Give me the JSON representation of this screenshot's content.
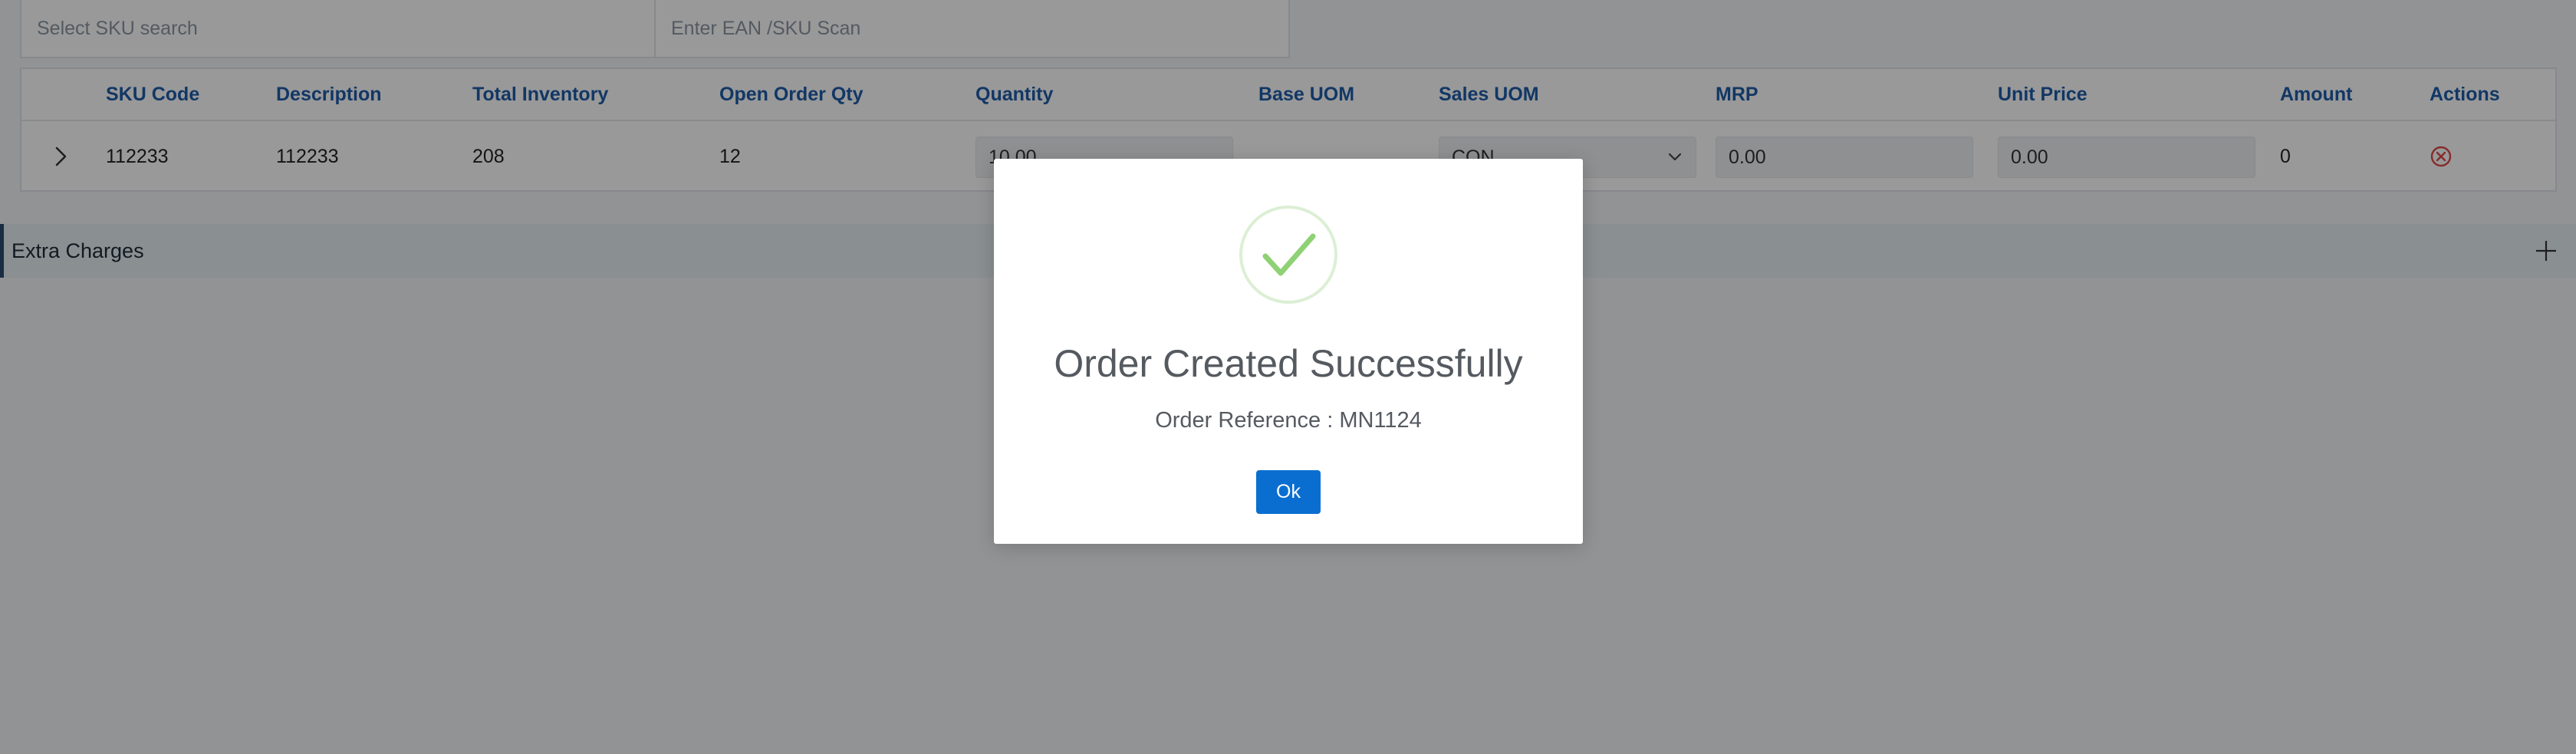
{
  "search": {
    "sku_placeholder": "Select SKU search",
    "ean_placeholder": "Enter EAN /SKU Scan"
  },
  "table": {
    "headers": {
      "sku_code": "SKU Code",
      "description": "Description",
      "total_inventory": "Total Inventory",
      "open_order_qty": "Open Order Qty",
      "quantity": "Quantity",
      "base_uom": "Base UOM",
      "sales_uom": "Sales UOM",
      "mrp": "MRP",
      "unit_price": "Unit Price",
      "amount": "Amount",
      "actions": "Actions"
    },
    "rows": [
      {
        "sku_code": "112233",
        "description": "112233",
        "total_inventory": "208",
        "open_order_qty": "12",
        "quantity": "10.00",
        "base_uom": "",
        "sales_uom": "CON",
        "mrp": "0.00",
        "unit_price": "0.00",
        "amount": "0"
      }
    ]
  },
  "extra_charges": {
    "label": "Extra Charges"
  },
  "modal": {
    "title": "Order Created Successfully",
    "reference": "Order Reference : MN1124",
    "ok_label": "Ok"
  },
  "colors": {
    "header_text": "#1e5da8",
    "success_green": "#8fd175",
    "ok_button": "#0a6ed1",
    "delete_icon": "#e04848",
    "overlay": "rgba(0,0,0,0.40)"
  },
  "icons": {
    "expand": "chevron-right-icon",
    "dropdown": "chevron-down-icon",
    "delete": "close-circle-icon",
    "add": "plus-icon",
    "success": "check-circle-icon"
  }
}
